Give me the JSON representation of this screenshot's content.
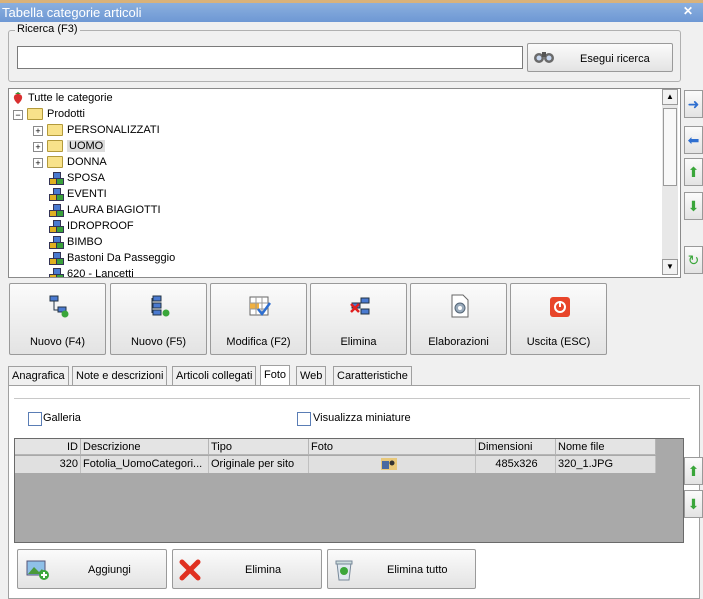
{
  "window": {
    "title": "Tabella categorie articoli",
    "close_label": "✕"
  },
  "search": {
    "group_label": "Ricerca (F3)",
    "value": "",
    "button_label": "Esegui ricerca"
  },
  "tree": {
    "root": "Tutte le categorie",
    "products": "Prodotti",
    "items": [
      "PERSONALIZZATI",
      "UOMO",
      "DONNA",
      "SPOSA",
      "EVENTI",
      "LAURA BIAGIOTTI",
      "IDROPROOF",
      "BIMBO",
      "Bastoni Da Passeggio",
      "620 - Lancetti"
    ],
    "selected": "UOMO"
  },
  "toolbar": {
    "nuovo_f4": "Nuovo (F4)",
    "nuovo_f5": "Nuovo (F5)",
    "modifica": "Modifica (F2)",
    "elimina": "Elimina",
    "elaborazioni": "Elaborazioni",
    "uscita": "Uscita (ESC)"
  },
  "tabs": [
    "Anagrafica",
    "Note e descrizioni",
    "Articoli collegati",
    "Foto",
    "Web",
    "Caratteristiche"
  ],
  "active_tab": "Foto",
  "foto": {
    "galleria_label": "Galleria",
    "miniature_label": "Visualizza miniature",
    "columns": [
      "ID",
      "Descrizione",
      "Tipo",
      "Foto",
      "Dimensioni",
      "Nome file"
    ],
    "rows": [
      {
        "id": "320",
        "descrizione": "Fotolia_UomoCategori...",
        "tipo": "Originale per sito",
        "foto": "",
        "dimensioni": "485x326",
        "nome_file": "320_1.JPG"
      }
    ]
  },
  "bottom": {
    "aggiungi": "Aggiungi",
    "elimina": "Elimina",
    "elimina_tutto": "Elimina tutto"
  },
  "colors": {
    "title_bar": "#7aa2d8",
    "grid_bg": "#a9a9a9",
    "green_arrow": "#3aa63a",
    "blue_arrow": "#2f6fd0"
  }
}
